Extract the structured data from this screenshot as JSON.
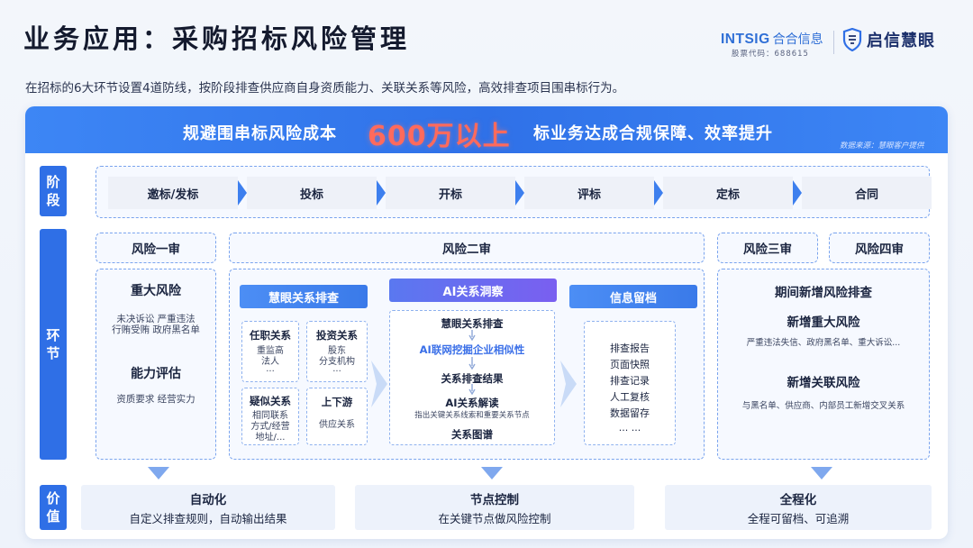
{
  "header": {
    "title": "业务应用：采购招标风险管理",
    "subtitle": "在招标的6大环节设置4道防线，按阶段排查供应商自身资质能力、关联关系等风险，高效排查项目围串标行为。",
    "intsig_word": "INTSIG",
    "intsig_cn": "合合信息",
    "stock_code": "股票代码：688615",
    "qx_name": "启信慧眼"
  },
  "banner": {
    "left": "规避围串标风险成本",
    "big": "600万以上",
    "right": "标业务达成合规保障、效率提升",
    "source": "数据来源：慧眼客户提供"
  },
  "side_labels": {
    "stage": "阶段",
    "link": "环节",
    "value": "价值"
  },
  "stages": [
    "邀标/发标",
    "投标",
    "开标",
    "评标",
    "定标",
    "合同"
  ],
  "reviews": {
    "r1": "风险一审",
    "r2": "风险二审",
    "r3": "风险三审",
    "r4": "风险四审"
  },
  "r1_box": {
    "major_title": "重大风险",
    "major_line1": "未决诉讼  严重违法",
    "major_line2": "行贿受贿  政府黑名单",
    "ability_title": "能力评估",
    "ability_line": "资质要求 经营实力"
  },
  "r2_box": {
    "relation_pill": "慧眼关系排查",
    "ai_pill": "AI关系洞察",
    "info_pill": "信息留档",
    "card1": {
      "title": "任职关系",
      "l1": "重监高",
      "l2": "法人",
      "l3": "..."
    },
    "card2": {
      "title": "投资关系",
      "l1": "股东",
      "l2": "分支机构",
      "l3": "..."
    },
    "card3": {
      "title": "疑似关系",
      "l1": "相同联系",
      "l2": "方式/经营",
      "l3": "地址/..."
    },
    "card4": {
      "title": "上下游",
      "l1": "供应关系"
    },
    "flow": {
      "s1": "慧眼关系排查",
      "s2": "AI联网挖掘企业相似性",
      "s3": "关系排查结果",
      "s4": "AI关系解读",
      "s4_sub": "指出关键关系线索和重要关系节点",
      "s5": "关系图谱"
    },
    "info_items": [
      "排查报告",
      "页面快照",
      "排查记录",
      "人工复核",
      "数据留存",
      "... ..."
    ]
  },
  "r34_box": {
    "head": "期间新增风险排查",
    "t1": "新增重大风险",
    "d1": "严重违法失信、政府黑名单、重大诉讼...",
    "t2": "新增关联风险",
    "d2": "与黑名单、供应商、内部员工新增交叉关系"
  },
  "values": [
    {
      "title": "自动化",
      "sub": "自定义排查规则，自动输出结果"
    },
    {
      "title": "节点控制",
      "sub": "在关键节点做风险控制"
    },
    {
      "title": "全程化",
      "sub": "全程可留档、可追溯"
    }
  ],
  "colors": {
    "accent": "#2f6fe6",
    "highlight": "#ff6a5c",
    "ai": "#6a6cf0"
  }
}
